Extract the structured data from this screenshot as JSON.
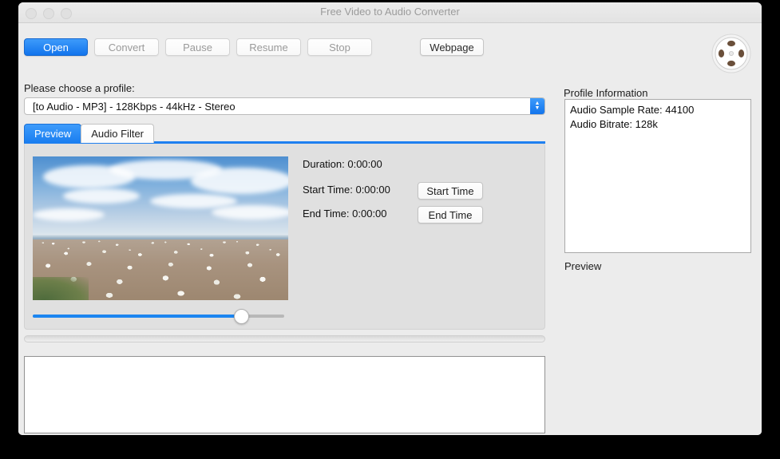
{
  "window": {
    "title": "Free Video to Audio Converter",
    "traffic_lights": [
      "close",
      "minimize",
      "zoom"
    ]
  },
  "toolbar": {
    "open_label": "Open",
    "convert_label": "Convert",
    "pause_label": "Pause",
    "resume_label": "Resume",
    "stop_label": "Stop",
    "webpage_label": "Webpage",
    "app_icon": "film-reel-icon"
  },
  "profile": {
    "prompt": "Please choose a profile:",
    "selected": "[to Audio - MP3] - 128Kbps - 44kHz - Stereo"
  },
  "tabs": [
    {
      "label": "Preview",
      "active": true
    },
    {
      "label": "Audio Filter",
      "active": false
    }
  ],
  "preview": {
    "thumbnail_alt": "gannet colony on beach under blue sky",
    "slider_value_percent": 85,
    "duration_label": "Duration: 0:00:00",
    "start_time_label": "Start Time: 0:00:00",
    "end_time_label": "End Time: 0:00:00",
    "start_time_button": "Start Time",
    "end_time_button": "End Time"
  },
  "profile_information": {
    "heading": "Profile Information",
    "lines": [
      "Audio Sample Rate: 44100",
      "Audio Bitrate: 128k"
    ],
    "caption": "Preview"
  },
  "progress": {
    "value_percent": 0
  },
  "log": {
    "text": ""
  },
  "colors": {
    "accent_blue": "#1b85f0",
    "window_bg": "#ececec",
    "panel_bg": "#e0e0e0",
    "title_text": "#9b9b9b",
    "disabled_text": "#9a9a9a"
  }
}
